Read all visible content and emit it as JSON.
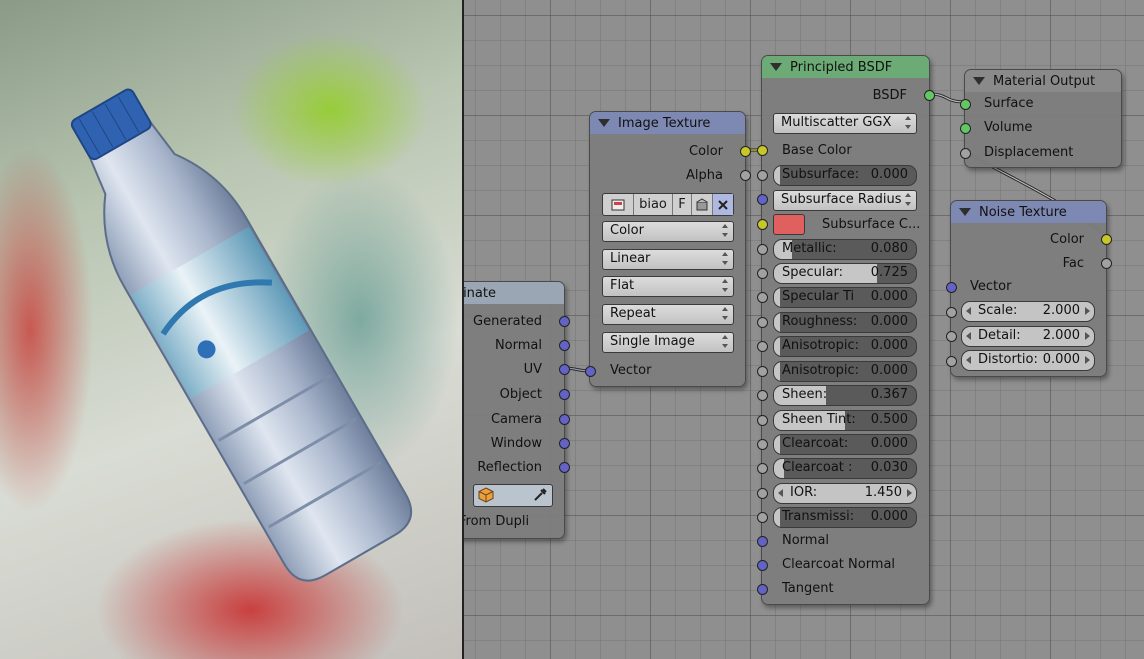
{
  "nodes": {
    "tex_coord": {
      "title": "Texture Coordinate",
      "outputs": [
        "Generated",
        "Normal",
        "UV",
        "Object",
        "Camera",
        "Window",
        "Reflection"
      ],
      "object_field_icon": "cube-icon",
      "eyedropper_icon": "eyedropper-icon",
      "from_dupli": "From Dupli"
    },
    "image_texture": {
      "title": "Image Texture",
      "outputs": [
        "Color",
        "Alpha"
      ],
      "image_name": "biao",
      "fake_user": "F",
      "image_type_icon": "image-icon",
      "pack_icon": "pack-icon",
      "unlink_icon": "close-icon",
      "color_space": "Color",
      "interpolation": "Linear",
      "projection": "Flat",
      "extension": "Repeat",
      "source": "Single Image",
      "input_vector": "Vector"
    },
    "principled": {
      "title": "Principled BSDF",
      "output": "BSDF",
      "distribution": "Multiscatter GGX",
      "base_color": "Base Color",
      "subsurface": {
        "label": "Subsurface:",
        "value": "0.000",
        "fraction": 0.0
      },
      "subsurface_method": "Subsurface Radius",
      "subsurface_color_label": "Subsurface C...",
      "subsurface_color_swatch": "#e06060",
      "metallic": {
        "label": "Metallic:",
        "value": "0.080",
        "fraction": 0.08
      },
      "specular": {
        "label": "Specular:",
        "value": "0.725",
        "fraction": 0.725
      },
      "specular_tint": {
        "label": "Specular Ti",
        "value": "0.000",
        "fraction": 0.0
      },
      "roughness": {
        "label": "Roughness:",
        "value": "0.000",
        "fraction": 0.0
      },
      "anisotropic": {
        "label": "Anisotropic:",
        "value": "0.000",
        "fraction": 0.0
      },
      "anisotropic_rot": {
        "label": "Anisotropic:",
        "value": "0.000",
        "fraction": 0.0
      },
      "sheen": {
        "label": "Sheen:",
        "value": "0.367",
        "fraction": 0.367
      },
      "sheen_tint": {
        "label": "Sheen Tint:",
        "value": "0.500",
        "fraction": 0.5
      },
      "clearcoat": {
        "label": "Clearcoat:",
        "value": "0.000",
        "fraction": 0.0
      },
      "clearcoat_rough": {
        "label": "Clearcoat :",
        "value": "0.030",
        "fraction": 0.03
      },
      "ior": {
        "label": "IOR:",
        "value": "1.450"
      },
      "transmission": {
        "label": "Transmissi:",
        "value": "0.000",
        "fraction": 0.0
      },
      "normal": "Normal",
      "clearcoat_normal": "Clearcoat Normal",
      "tangent": "Tangent"
    },
    "material_output": {
      "title": "Material Output",
      "inputs": [
        "Surface",
        "Volume",
        "Displacement"
      ]
    },
    "noise": {
      "title": "Noise Texture",
      "outputs": [
        "Color",
        "Fac"
      ],
      "input_vector": "Vector",
      "scale": {
        "label": "Scale:",
        "value": "2.000"
      },
      "detail": {
        "label": "Detail:",
        "value": "2.000"
      },
      "distortion": {
        "label": "Distortio:",
        "value": "0.000"
      }
    }
  },
  "colors": {
    "shader_header": "#6cab75",
    "texture_header": "#7e89b3",
    "output_header": "#8a8a8a",
    "socket_color": "#c7c729",
    "socket_shader": "#63c763",
    "socket_vector": "#6363c7",
    "socket_float": "#a1a1a1"
  }
}
